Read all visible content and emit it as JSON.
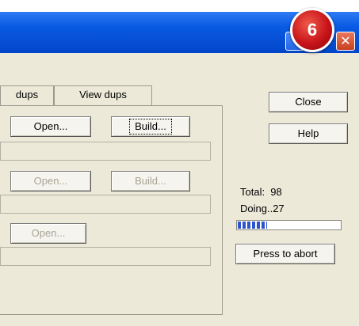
{
  "badge": {
    "number": "6"
  },
  "titlebar": {
    "title": "",
    "close_glyph": "✕"
  },
  "tabs": [
    {
      "label": "dups"
    },
    {
      "label": "View dups"
    }
  ],
  "rows": [
    {
      "open_label": "Open...",
      "build_label": "Build..."
    },
    {
      "open_label": "Open...",
      "build_label": "Build..."
    },
    {
      "open_label": "Open..."
    }
  ],
  "side": {
    "close_label": "Close",
    "help_label": "Help",
    "total_text": "Total:  98",
    "doing_text": "Doing..27",
    "abort_label": "Press to abort"
  },
  "progress": {
    "fraction": 0.28,
    "color": "#2d54cc"
  },
  "colors": {
    "title_bar": "#0a5ae3",
    "window_bg": "#ece9d8",
    "badge": "#c8141a"
  }
}
